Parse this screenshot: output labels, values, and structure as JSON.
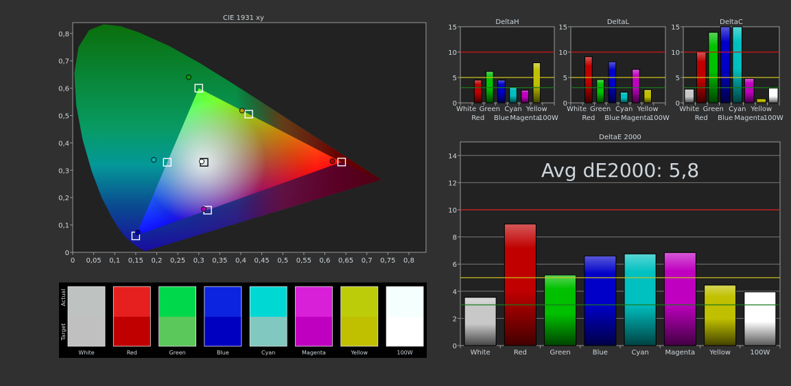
{
  "chart_data": [
    {
      "id": "cie",
      "type": "scatter",
      "title": "CIE 1931 xy",
      "xlim": [
        0,
        0.84
      ],
      "ylim": [
        0,
        0.84
      ],
      "xticks": [
        "0",
        "0,05",
        "0,1",
        "0,15",
        "0,2",
        "0,25",
        "0,3",
        "0,35",
        "0,4",
        "0,45",
        "0,5",
        "0,55",
        "0,6",
        "0,65",
        "0,7",
        "0,75",
        "0,8"
      ],
      "xtick_values": [
        0,
        0.05,
        0.1,
        0.15,
        0.2,
        0.25,
        0.3,
        0.35,
        0.4,
        0.45,
        0.5,
        0.55,
        0.6,
        0.65,
        0.7,
        0.75,
        0.8
      ],
      "yticks": [
        "0",
        "0,1",
        "0,2",
        "0,3",
        "0,4",
        "0,5",
        "0,6",
        "0,7",
        "0,8"
      ],
      "ytick_values": [
        0,
        0.1,
        0.2,
        0.3,
        0.4,
        0.5,
        0.6,
        0.7,
        0.8
      ],
      "targets": [
        {
          "name": "White",
          "x": 0.3127,
          "y": 0.329
        },
        {
          "name": "Red",
          "x": 0.64,
          "y": 0.33
        },
        {
          "name": "Green",
          "x": 0.3,
          "y": 0.6
        },
        {
          "name": "Blue",
          "x": 0.15,
          "y": 0.06
        },
        {
          "name": "Cyan",
          "x": 0.225,
          "y": 0.329
        },
        {
          "name": "Magenta",
          "x": 0.321,
          "y": 0.154
        },
        {
          "name": "Yellow",
          "x": 0.419,
          "y": 0.505
        }
      ],
      "actual": [
        {
          "name": "White",
          "x": 0.307,
          "y": 0.332,
          "color": "#ffffff"
        },
        {
          "name": "Red",
          "x": 0.618,
          "y": 0.333,
          "color": "#c00000"
        },
        {
          "name": "Green",
          "x": 0.276,
          "y": 0.64,
          "color": "#00a000"
        },
        {
          "name": "Blue",
          "x": 0.155,
          "y": 0.073,
          "color": "#0000b0"
        },
        {
          "name": "Cyan",
          "x": 0.193,
          "y": 0.338,
          "color": "#00b8b8"
        },
        {
          "name": "Magenta",
          "x": 0.312,
          "y": 0.158,
          "color": "#b000b0"
        },
        {
          "name": "Yellow",
          "x": 0.403,
          "y": 0.518,
          "color": "#b0a000"
        }
      ]
    },
    {
      "id": "deltaH",
      "type": "bar",
      "title": "DeltaH",
      "ylim": [
        0,
        15
      ],
      "yticks": [
        0,
        5,
        10,
        15
      ],
      "categories": [
        "White",
        "Red",
        "Green",
        "Blue",
        "Cyan",
        "Magenta",
        "Yellow",
        "100W"
      ],
      "values": [
        0,
        4.5,
        6.2,
        4.5,
        3.1,
        2.5,
        7.9,
        0
      ]
    },
    {
      "id": "deltaL",
      "type": "bar",
      "title": "DeltaL",
      "ylim": [
        0,
        15
      ],
      "yticks": [
        0,
        5,
        10,
        15
      ],
      "categories": [
        "White",
        "Red",
        "Green",
        "Blue",
        "Cyan",
        "Magenta",
        "Yellow",
        "100W"
      ],
      "values": [
        0,
        9.1,
        4.6,
        8.1,
        2.1,
        6.6,
        2.6,
        0
      ]
    },
    {
      "id": "deltaC",
      "type": "bar",
      "title": "DeltaC",
      "ylim": [
        0,
        15
      ],
      "yticks": [
        0,
        5,
        10,
        15
      ],
      "categories": [
        "White",
        "Red",
        "Green",
        "Blue",
        "Cyan",
        "Magenta",
        "Yellow",
        "100W"
      ],
      "values": [
        2.7,
        10.1,
        13.9,
        15,
        15,
        4.8,
        0.8,
        2.9
      ]
    },
    {
      "id": "deltaE",
      "type": "bar",
      "title": "DeltaE 2000",
      "ylim": [
        0,
        15
      ],
      "yticks": [
        0,
        2,
        4,
        6,
        8,
        10,
        12,
        14
      ],
      "categories": [
        "White",
        "Red",
        "Green",
        "Blue",
        "Cyan",
        "Magenta",
        "Yellow",
        "100W"
      ],
      "values": [
        3.55,
        8.95,
        5.2,
        6.6,
        6.75,
        6.85,
        4.45,
        3.95
      ],
      "annotation": "Avg dE2000: 5,8"
    }
  ],
  "reference_lines": [
    {
      "value": 10,
      "color": "#d01818"
    },
    {
      "value": 5,
      "color": "#c8c020"
    },
    {
      "value": 3,
      "color": "#1c7a1c"
    }
  ],
  "bar_colors": [
    "#c8c8c8",
    "#c00000",
    "#00c000",
    "#0000c8",
    "#00c0c0",
    "#c000c0",
    "#c0c000",
    "#ffffff"
  ],
  "swatches": {
    "row_labels": [
      "Actual",
      "Target"
    ],
    "items": [
      {
        "name": "White",
        "actual": "#bec3c2",
        "target": "#c0c0c0"
      },
      {
        "name": "Red",
        "actual": "#e5201e",
        "target": "#c00000"
      },
      {
        "name": "Green",
        "actual": "#00d84c",
        "target": "#5ac85a"
      },
      {
        "name": "Blue",
        "actual": "#0c24e0",
        "target": "#0000c0"
      },
      {
        "name": "Cyan",
        "actual": "#00d8d4",
        "target": "#80c8c0"
      },
      {
        "name": "Magenta",
        "actual": "#d820d8",
        "target": "#c000c0"
      },
      {
        "name": "Yellow",
        "actual": "#bccc08",
        "target": "#c0c000"
      },
      {
        "name": "100W",
        "actual": "#f4fffe",
        "target": "#ffffff"
      }
    ]
  }
}
